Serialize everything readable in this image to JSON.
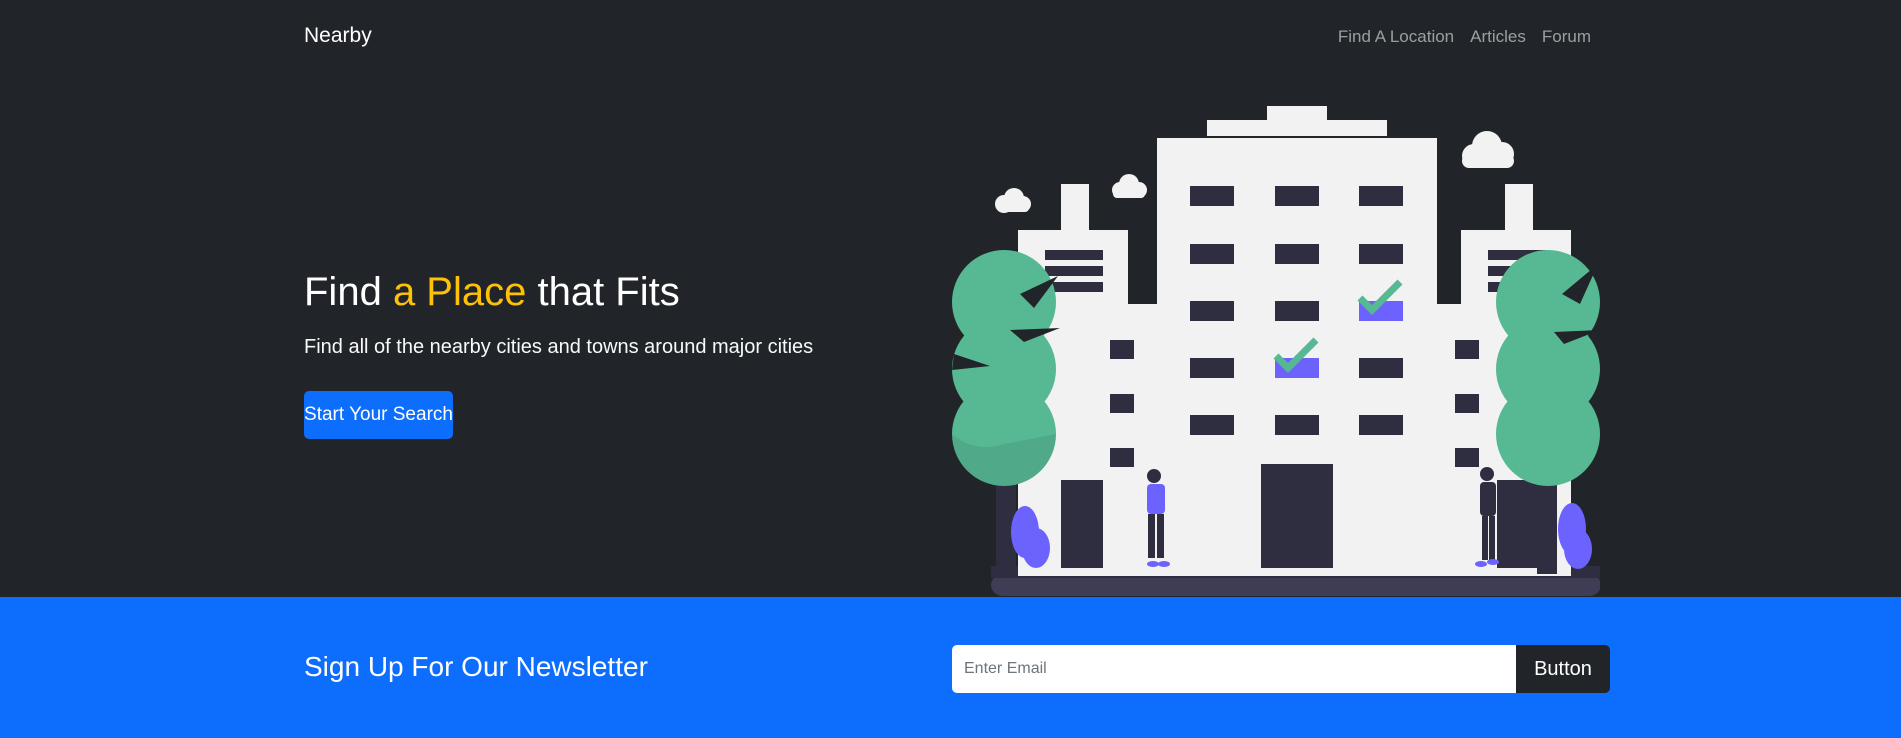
{
  "navbar": {
    "brand": "Nearby",
    "links": [
      "Find A Location",
      "Articles",
      "Forum"
    ]
  },
  "hero": {
    "title_part1": "Find ",
    "title_accent": "a Place",
    "title_part2": " that Fits",
    "subtitle": "Find all of the nearby cities and towns around major cities",
    "cta_label": "Start Your Search"
  },
  "newsletter": {
    "title": "Sign Up For Our Newsletter",
    "email_placeholder": "Enter Email",
    "button_label": "Button"
  },
  "colors": {
    "dark": "#212529",
    "accent": "#ffc107",
    "primary": "#0d6efd",
    "tree_green": "#57b894",
    "purple": "#6c63ff"
  }
}
